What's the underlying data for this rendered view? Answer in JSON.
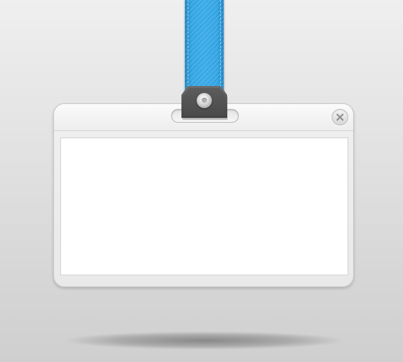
{
  "scene": {
    "background_color": "#e4e4e4",
    "lanyard_color": "#33a5e3",
    "clip_color": "#555555",
    "card_color": "#efefef",
    "window_color": "#ffffff"
  },
  "icons": {
    "close": "close-circle-icon",
    "rivet": "rivet-icon"
  }
}
